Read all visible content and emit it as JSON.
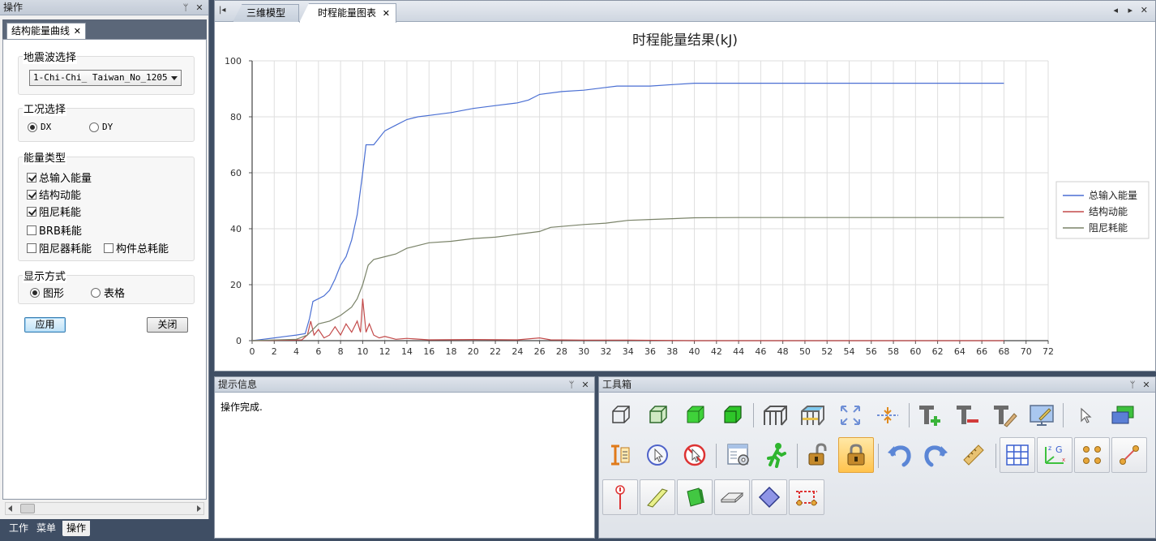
{
  "left_panel": {
    "title": "操作",
    "pin": "ᛘ",
    "close": "✕",
    "tab_label": "结构能量曲线",
    "tab_close": "✕",
    "wave_group_label": "地震波选择",
    "wave_selected": "1-Chi-Chi_ Taiwan_No_1205",
    "case_group_label": "工况选择",
    "case_dx": "DX",
    "case_dy": "DY",
    "energy_group_label": "能量类型",
    "energy_total": "总输入能量",
    "energy_kinetic": "结构动能",
    "energy_damping": "阻尼耗能",
    "energy_brb": "BRB耗能",
    "energy_damper": "阻尼器耗能",
    "energy_member": "构件总耗能",
    "display_group_label": "显示方式",
    "display_graph": "图形",
    "display_table": "表格",
    "apply_label": "应用",
    "close_label": "关闭"
  },
  "bottom_tabs": [
    "工作",
    "菜单",
    "操作"
  ],
  "doc_tabs": {
    "tab1": "三维模型",
    "tab2": "时程能量图表",
    "tab2_close": "✕",
    "nav_first": "|◂",
    "nav_prev": "◂",
    "nav_next": "▸",
    "nav_close": "✕"
  },
  "message_panel": {
    "title": "提示信息",
    "text": "操作完成."
  },
  "toolbox": {
    "title": "工具箱"
  },
  "colors": {
    "total": "#4a6fd3",
    "kinetic": "#c34a4a",
    "damping": "#7a8369"
  },
  "chart_data": {
    "type": "line",
    "title": "时程能量结果(kJ)",
    "xlim": [
      0,
      72
    ],
    "ylim": [
      0,
      100
    ],
    "x_ticks": [
      0,
      2,
      4,
      6,
      8,
      10,
      12,
      14,
      16,
      18,
      20,
      22,
      24,
      26,
      28,
      30,
      32,
      34,
      36,
      38,
      40,
      42,
      44,
      46,
      48,
      50,
      52,
      54,
      56,
      58,
      60,
      62,
      64,
      66,
      68,
      70,
      72
    ],
    "y_ticks": [
      0,
      20,
      40,
      60,
      80,
      100
    ],
    "grid": true,
    "legend": "right",
    "series": [
      {
        "name": "总输入能量",
        "color": "#4a6fd3",
        "points": [
          [
            0,
            0
          ],
          [
            1,
            0.5
          ],
          [
            2,
            1
          ],
          [
            3,
            1.5
          ],
          [
            4,
            2
          ],
          [
            4.8,
            2.5
          ],
          [
            5.2,
            8
          ],
          [
            5.5,
            14
          ],
          [
            6,
            15
          ],
          [
            6.5,
            16
          ],
          [
            7,
            18
          ],
          [
            7.5,
            22
          ],
          [
            8,
            27
          ],
          [
            8.5,
            30
          ],
          [
            9,
            36
          ],
          [
            9.5,
            45
          ],
          [
            10,
            60
          ],
          [
            10.3,
            70
          ],
          [
            11,
            70
          ],
          [
            12,
            75
          ],
          [
            13,
            77
          ],
          [
            14,
            79
          ],
          [
            15,
            80
          ],
          [
            16,
            80.5
          ],
          [
            18,
            81.5
          ],
          [
            20,
            83
          ],
          [
            22,
            84
          ],
          [
            24,
            85
          ],
          [
            25,
            86
          ],
          [
            26,
            88
          ],
          [
            28,
            89
          ],
          [
            30,
            89.5
          ],
          [
            32,
            90.5
          ],
          [
            33,
            91
          ],
          [
            36,
            91
          ],
          [
            38,
            91.5
          ],
          [
            40,
            92
          ],
          [
            50,
            92
          ],
          [
            60,
            92
          ],
          [
            68,
            92
          ]
        ]
      },
      {
        "name": "结构动能",
        "color": "#c34a4a",
        "points": [
          [
            0,
            0
          ],
          [
            4.5,
            0.3
          ],
          [
            5,
            2
          ],
          [
            5.3,
            7
          ],
          [
            5.6,
            2
          ],
          [
            6,
            4
          ],
          [
            6.5,
            1
          ],
          [
            7,
            2
          ],
          [
            7.5,
            5
          ],
          [
            8,
            2
          ],
          [
            8.5,
            6
          ],
          [
            9,
            3
          ],
          [
            9.5,
            7
          ],
          [
            9.8,
            3
          ],
          [
            10,
            15
          ],
          [
            10.3,
            3
          ],
          [
            10.6,
            6
          ],
          [
            11,
            2
          ],
          [
            11.5,
            1
          ],
          [
            12,
            1.5
          ],
          [
            13,
            0.5
          ],
          [
            14,
            0.8
          ],
          [
            16,
            0.3
          ],
          [
            20,
            0.4
          ],
          [
            24,
            0.3
          ],
          [
            26,
            1
          ],
          [
            27,
            0.3
          ],
          [
            30,
            0.2
          ],
          [
            34,
            0.2
          ],
          [
            40,
            0
          ],
          [
            68,
            0
          ]
        ]
      },
      {
        "name": "阻尼耗能",
        "color": "#7a8369",
        "points": [
          [
            0,
            0
          ],
          [
            4,
            0.5
          ],
          [
            5,
            2
          ],
          [
            5.5,
            4
          ],
          [
            6,
            6
          ],
          [
            7,
            7
          ],
          [
            8,
            9
          ],
          [
            9,
            12
          ],
          [
            9.5,
            15
          ],
          [
            10,
            20
          ],
          [
            10.5,
            27
          ],
          [
            11,
            29
          ],
          [
            12,
            30
          ],
          [
            13,
            31
          ],
          [
            14,
            33
          ],
          [
            15,
            34
          ],
          [
            16,
            35
          ],
          [
            18,
            35.5
          ],
          [
            20,
            36.5
          ],
          [
            22,
            37
          ],
          [
            24,
            38
          ],
          [
            26,
            39
          ],
          [
            27,
            40.5
          ],
          [
            30,
            41.5
          ],
          [
            32,
            42
          ],
          [
            34,
            43
          ],
          [
            36,
            43.3
          ],
          [
            38,
            43.6
          ],
          [
            40,
            43.9
          ],
          [
            44,
            44
          ],
          [
            68,
            44
          ]
        ]
      }
    ]
  }
}
